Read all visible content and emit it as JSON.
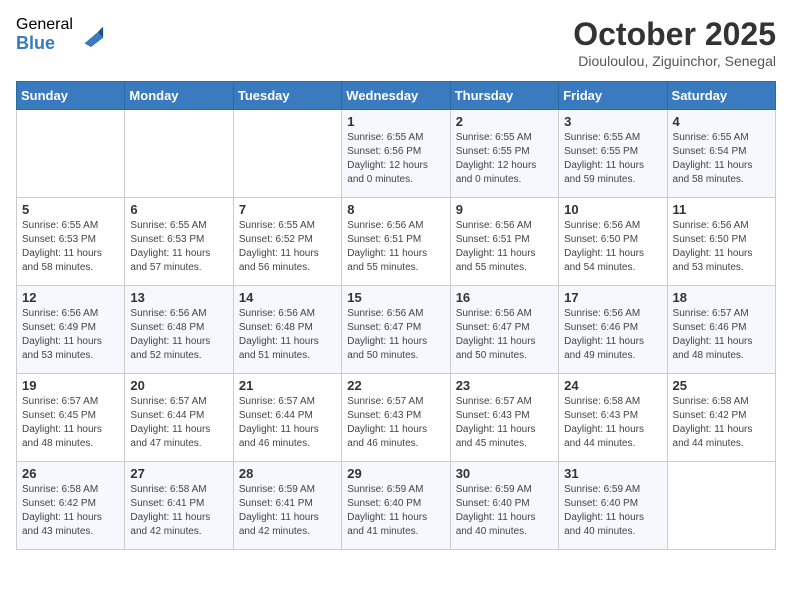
{
  "header": {
    "logo_general": "General",
    "logo_blue": "Blue",
    "month_title": "October 2025",
    "location": "Diouloulou, Ziguinchor, Senegal"
  },
  "weekdays": [
    "Sunday",
    "Monday",
    "Tuesday",
    "Wednesday",
    "Thursday",
    "Friday",
    "Saturday"
  ],
  "weeks": [
    [
      {
        "day": "",
        "info": ""
      },
      {
        "day": "",
        "info": ""
      },
      {
        "day": "",
        "info": ""
      },
      {
        "day": "1",
        "info": "Sunrise: 6:55 AM\nSunset: 6:56 PM\nDaylight: 12 hours\nand 0 minutes."
      },
      {
        "day": "2",
        "info": "Sunrise: 6:55 AM\nSunset: 6:55 PM\nDaylight: 12 hours\nand 0 minutes."
      },
      {
        "day": "3",
        "info": "Sunrise: 6:55 AM\nSunset: 6:55 PM\nDaylight: 11 hours\nand 59 minutes."
      },
      {
        "day": "4",
        "info": "Sunrise: 6:55 AM\nSunset: 6:54 PM\nDaylight: 11 hours\nand 58 minutes."
      }
    ],
    [
      {
        "day": "5",
        "info": "Sunrise: 6:55 AM\nSunset: 6:53 PM\nDaylight: 11 hours\nand 58 minutes."
      },
      {
        "day": "6",
        "info": "Sunrise: 6:55 AM\nSunset: 6:53 PM\nDaylight: 11 hours\nand 57 minutes."
      },
      {
        "day": "7",
        "info": "Sunrise: 6:55 AM\nSunset: 6:52 PM\nDaylight: 11 hours\nand 56 minutes."
      },
      {
        "day": "8",
        "info": "Sunrise: 6:56 AM\nSunset: 6:51 PM\nDaylight: 11 hours\nand 55 minutes."
      },
      {
        "day": "9",
        "info": "Sunrise: 6:56 AM\nSunset: 6:51 PM\nDaylight: 11 hours\nand 55 minutes."
      },
      {
        "day": "10",
        "info": "Sunrise: 6:56 AM\nSunset: 6:50 PM\nDaylight: 11 hours\nand 54 minutes."
      },
      {
        "day": "11",
        "info": "Sunrise: 6:56 AM\nSunset: 6:50 PM\nDaylight: 11 hours\nand 53 minutes."
      }
    ],
    [
      {
        "day": "12",
        "info": "Sunrise: 6:56 AM\nSunset: 6:49 PM\nDaylight: 11 hours\nand 53 minutes."
      },
      {
        "day": "13",
        "info": "Sunrise: 6:56 AM\nSunset: 6:48 PM\nDaylight: 11 hours\nand 52 minutes."
      },
      {
        "day": "14",
        "info": "Sunrise: 6:56 AM\nSunset: 6:48 PM\nDaylight: 11 hours\nand 51 minutes."
      },
      {
        "day": "15",
        "info": "Sunrise: 6:56 AM\nSunset: 6:47 PM\nDaylight: 11 hours\nand 50 minutes."
      },
      {
        "day": "16",
        "info": "Sunrise: 6:56 AM\nSunset: 6:47 PM\nDaylight: 11 hours\nand 50 minutes."
      },
      {
        "day": "17",
        "info": "Sunrise: 6:56 AM\nSunset: 6:46 PM\nDaylight: 11 hours\nand 49 minutes."
      },
      {
        "day": "18",
        "info": "Sunrise: 6:57 AM\nSunset: 6:46 PM\nDaylight: 11 hours\nand 48 minutes."
      }
    ],
    [
      {
        "day": "19",
        "info": "Sunrise: 6:57 AM\nSunset: 6:45 PM\nDaylight: 11 hours\nand 48 minutes."
      },
      {
        "day": "20",
        "info": "Sunrise: 6:57 AM\nSunset: 6:44 PM\nDaylight: 11 hours\nand 47 minutes."
      },
      {
        "day": "21",
        "info": "Sunrise: 6:57 AM\nSunset: 6:44 PM\nDaylight: 11 hours\nand 46 minutes."
      },
      {
        "day": "22",
        "info": "Sunrise: 6:57 AM\nSunset: 6:43 PM\nDaylight: 11 hours\nand 46 minutes."
      },
      {
        "day": "23",
        "info": "Sunrise: 6:57 AM\nSunset: 6:43 PM\nDaylight: 11 hours\nand 45 minutes."
      },
      {
        "day": "24",
        "info": "Sunrise: 6:58 AM\nSunset: 6:43 PM\nDaylight: 11 hours\nand 44 minutes."
      },
      {
        "day": "25",
        "info": "Sunrise: 6:58 AM\nSunset: 6:42 PM\nDaylight: 11 hours\nand 44 minutes."
      }
    ],
    [
      {
        "day": "26",
        "info": "Sunrise: 6:58 AM\nSunset: 6:42 PM\nDaylight: 11 hours\nand 43 minutes."
      },
      {
        "day": "27",
        "info": "Sunrise: 6:58 AM\nSunset: 6:41 PM\nDaylight: 11 hours\nand 42 minutes."
      },
      {
        "day": "28",
        "info": "Sunrise: 6:59 AM\nSunset: 6:41 PM\nDaylight: 11 hours\nand 42 minutes."
      },
      {
        "day": "29",
        "info": "Sunrise: 6:59 AM\nSunset: 6:40 PM\nDaylight: 11 hours\nand 41 minutes."
      },
      {
        "day": "30",
        "info": "Sunrise: 6:59 AM\nSunset: 6:40 PM\nDaylight: 11 hours\nand 40 minutes."
      },
      {
        "day": "31",
        "info": "Sunrise: 6:59 AM\nSunset: 6:40 PM\nDaylight: 11 hours\nand 40 minutes."
      },
      {
        "day": "",
        "info": ""
      }
    ]
  ]
}
